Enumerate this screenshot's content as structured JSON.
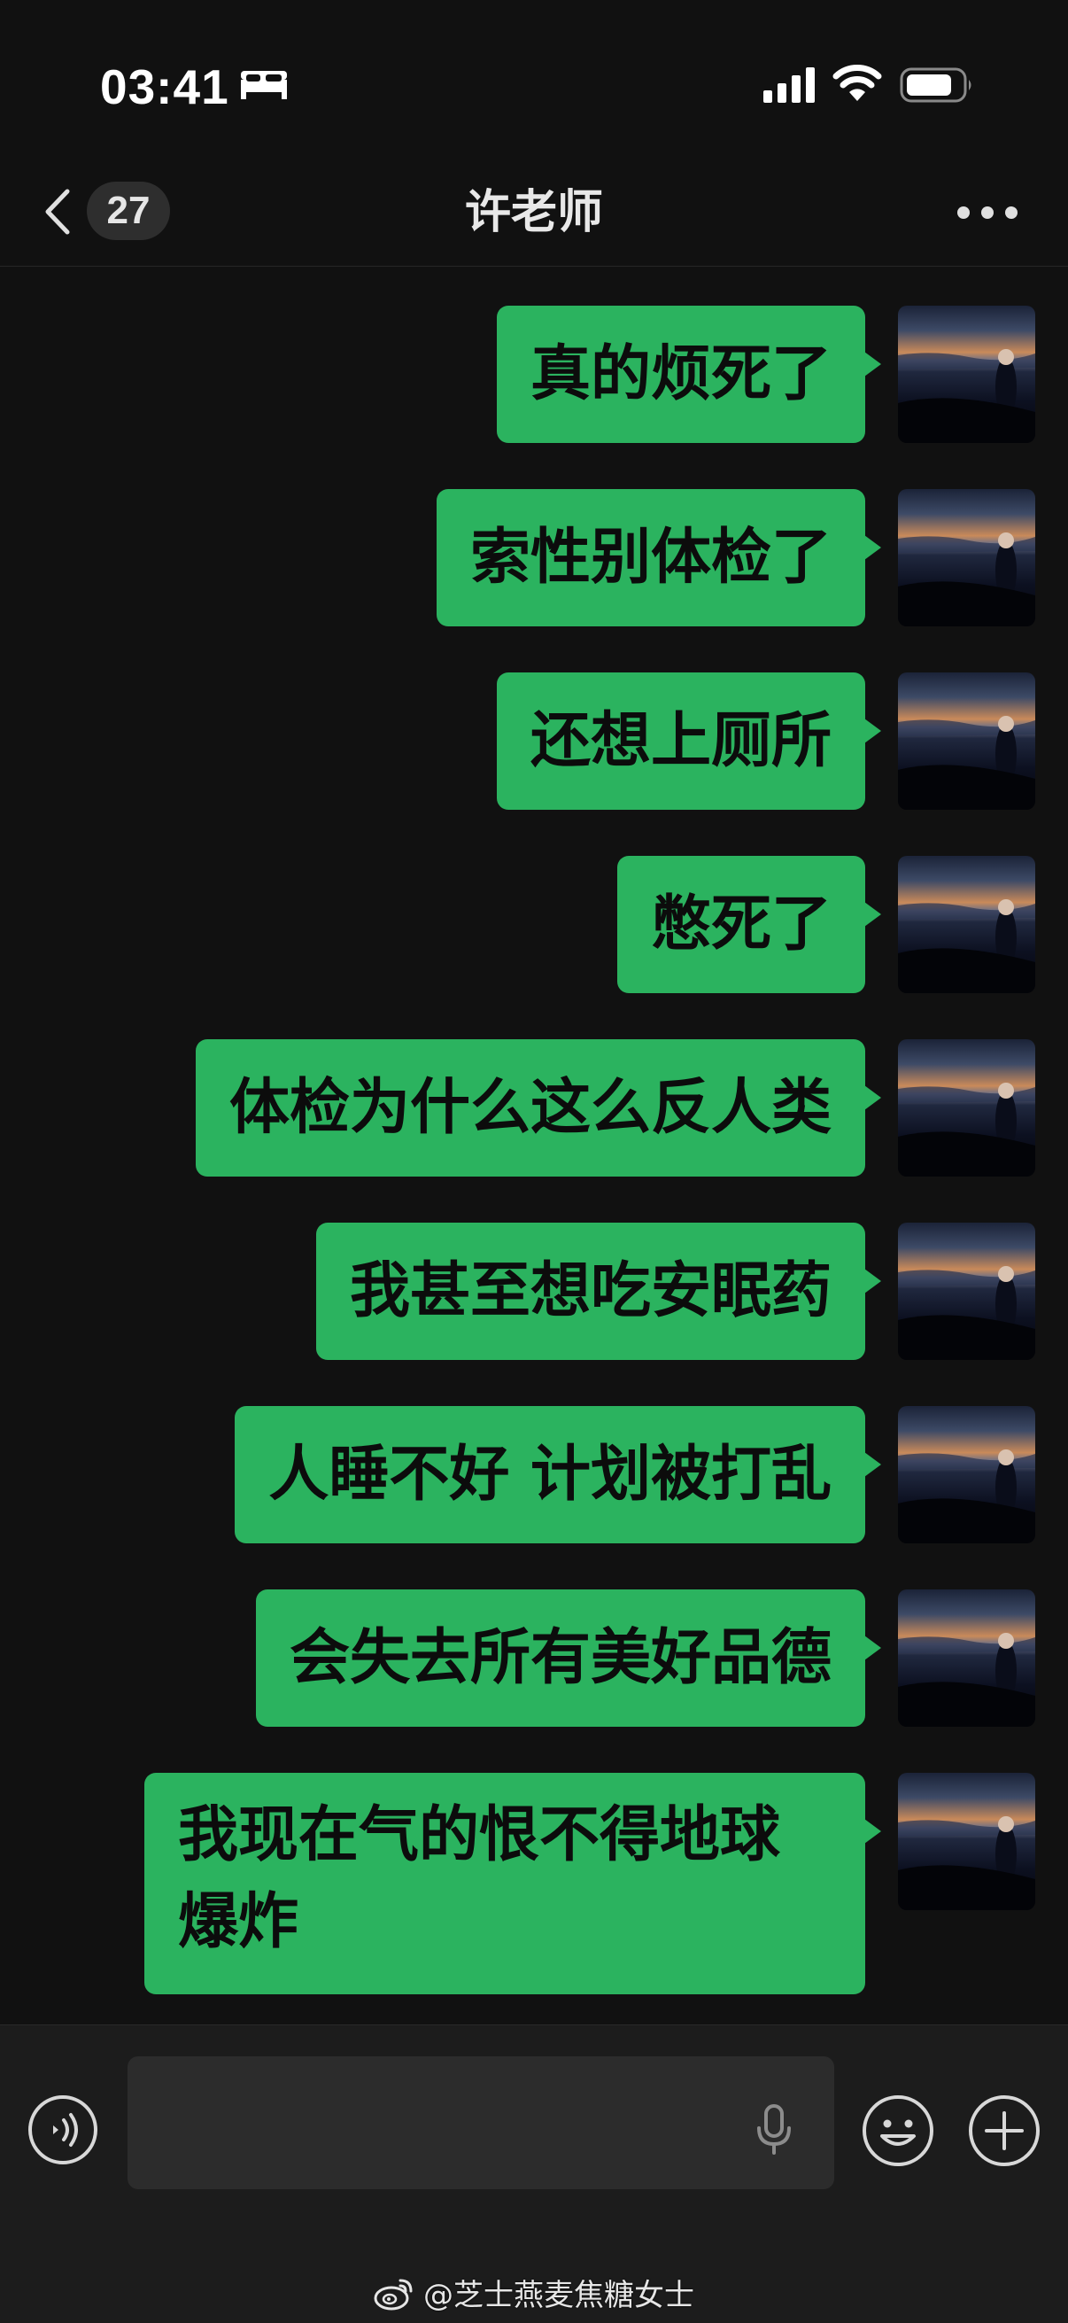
{
  "status_bar": {
    "time": "03:41",
    "sleep_icon": "bed-icon",
    "signal_icon": "cellular-signal-icon",
    "wifi_icon": "wifi-icon",
    "battery_icon": "battery-icon"
  },
  "nav": {
    "back_icon": "chevron-left-icon",
    "unread_count": "27",
    "title": "许老师",
    "more_icon": "more-dots-icon"
  },
  "messages": [
    {
      "text": "真的烦死了",
      "sender": "self"
    },
    {
      "text": "索性别体检了",
      "sender": "self"
    },
    {
      "text": "还想上厕所",
      "sender": "self"
    },
    {
      "text": "憋死了",
      "sender": "self"
    },
    {
      "text": "体检为什么这么反人类",
      "sender": "self"
    },
    {
      "text": "我甚至想吃安眠药",
      "sender": "self"
    },
    {
      "text": "人睡不好 计划被打乱",
      "sender": "self"
    },
    {
      "text": "会失去所有美好品德",
      "sender": "self"
    },
    {
      "text": "我现在气的恨不得地球爆炸",
      "sender": "self"
    }
  ],
  "input_bar": {
    "voice_icon": "voice-mode-icon",
    "input_value": "",
    "mic_icon": "microphone-icon",
    "emoji_icon": "emoji-icon",
    "plus_icon": "plus-circle-icon"
  },
  "watermark": {
    "logo": "weibo-logo",
    "text": "@芝士燕麦焦糖女士"
  },
  "colors": {
    "background": "#111111",
    "bubble_self": "#2bb35f",
    "input_bar": "#1c1c1c"
  }
}
